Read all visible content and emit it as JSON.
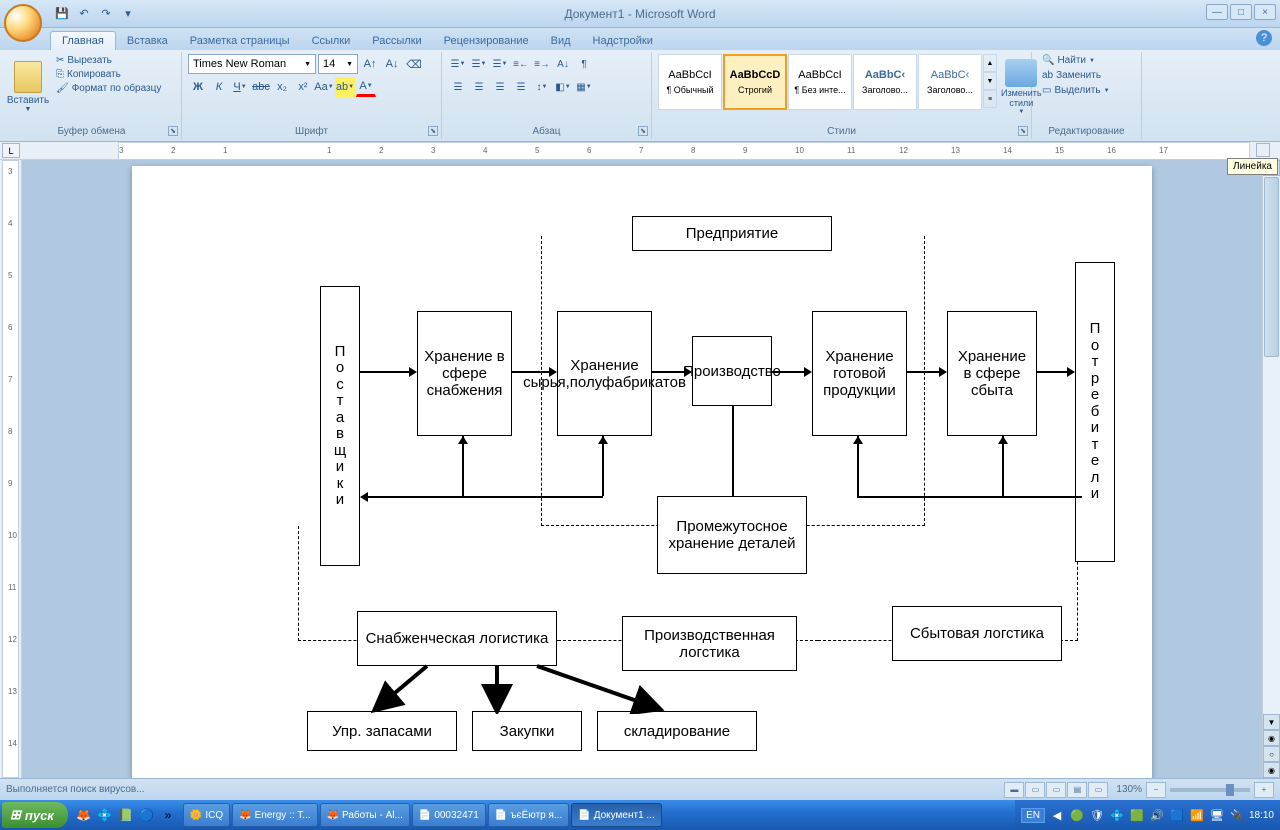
{
  "title": "Документ1 - Microsoft Word",
  "qat": {
    "save": "💾",
    "undo": "↶",
    "redo": "↷",
    "more": "▾"
  },
  "tabs": [
    "Главная",
    "Вставка",
    "Разметка страницы",
    "Ссылки",
    "Рассылки",
    "Рецензирование",
    "Вид",
    "Надстройки"
  ],
  "active_tab": 0,
  "ribbon": {
    "clipboard": {
      "label": "Буфер обмена",
      "paste": "Вставить",
      "cut": "Вырезать",
      "copy": "Копировать",
      "format_painter": "Формат по образцу"
    },
    "font": {
      "label": "Шрифт",
      "family": "Times New Roman",
      "size": "14"
    },
    "paragraph": {
      "label": "Абзац"
    },
    "styles": {
      "label": "Стили",
      "items": [
        {
          "preview": "AaBbCcI",
          "name": "¶ Обычный"
        },
        {
          "preview": "AaBbCcD",
          "name": "Строгий"
        },
        {
          "preview": "AaBbCcI",
          "name": "¶ Без инте..."
        },
        {
          "preview": "AaBbC‹",
          "name": "Заголово..."
        },
        {
          "preview": "AaBbC‹",
          "name": "Заголово..."
        }
      ],
      "change": "Изменить стили"
    },
    "editing": {
      "label": "Редактирование",
      "find": "Найти",
      "replace": "Заменить",
      "select": "Выделить"
    }
  },
  "ruler_tooltip": "Линейка",
  "ruler_numbers": [
    "3",
    "2",
    "1",
    "",
    "1",
    "2",
    "3",
    "4",
    "5",
    "6",
    "7",
    "8",
    "9",
    "10",
    "11",
    "12",
    "13",
    "14",
    "15",
    "16",
    "17"
  ],
  "vruler_numbers": [
    "3",
    "4",
    "5",
    "6",
    "7",
    "8",
    "9",
    "10",
    "11",
    "12",
    "13",
    "14"
  ],
  "diagram": {
    "enterprise": "Предприятие",
    "suppliers": "П о с т а в щ и к и",
    "consumers": "П о т р е б и т е л и",
    "supply_storage": "Хранение в сфере снабжения",
    "raw_storage": "Хранение сырья,полуфабрикатов",
    "production": "Производство",
    "finished_storage": "Хранение готовой продукции",
    "sales_storage": "Хранение в сфере сбыта",
    "intermediate": "Промежутосное хранение деталей",
    "supply_log": "Снабженческая логистика",
    "prod_log": "Производственная логстика",
    "sales_log": "Сбытовая логстика",
    "inventory": "Упр. запасами",
    "purchasing": "Закупки",
    "warehousing": "складирование"
  },
  "status": {
    "text": "Выполняется поиск вирусов...",
    "zoom": "130%"
  },
  "taskbar": {
    "start": "пуск",
    "items": [
      "ICQ",
      "Energy :: T...",
      "Работы - Al...",
      "00032471",
      "ъєЁютр  я...",
      "Документ1 ..."
    ],
    "lang": "EN",
    "time": "18:10"
  }
}
